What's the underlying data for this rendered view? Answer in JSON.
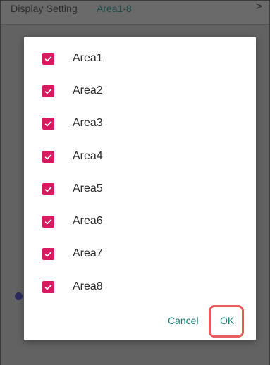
{
  "background": {
    "title": "Display Setting",
    "value": "Area1-8",
    "chevron": ">"
  },
  "dialog": {
    "items": [
      {
        "label": "Area1",
        "checked": true
      },
      {
        "label": "Area2",
        "checked": true
      },
      {
        "label": "Area3",
        "checked": true
      },
      {
        "label": "Area4",
        "checked": true
      },
      {
        "label": "Area5",
        "checked": true
      },
      {
        "label": "Area6",
        "checked": true
      },
      {
        "label": "Area7",
        "checked": true
      },
      {
        "label": "Area8",
        "checked": true
      }
    ],
    "cancel_label": "Cancel",
    "ok_label": "OK"
  },
  "colors": {
    "checkbox": "#d81b60",
    "button_text": "#1b7c77",
    "highlight": "#ec5b5b"
  }
}
